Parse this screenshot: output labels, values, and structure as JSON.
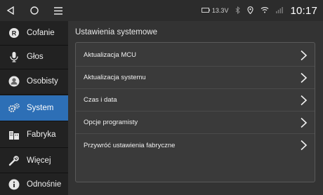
{
  "status_bar": {
    "battery_voltage": "13.3V",
    "time": "10:17"
  },
  "sidebar": {
    "items": [
      {
        "label": "Cofanie",
        "icon": "reverse-icon"
      },
      {
        "label": "Głos",
        "icon": "microphone-icon"
      },
      {
        "label": "Osobisty",
        "icon": "person-icon"
      },
      {
        "label": "System",
        "icon": "gears-icon",
        "active": true
      },
      {
        "label": "Fabryka",
        "icon": "factory-icon"
      },
      {
        "label": "Więcej",
        "icon": "wrench-icon"
      },
      {
        "label": "Odnośnie",
        "icon": "info-icon"
      }
    ]
  },
  "main": {
    "title": "Ustawienia systemowe",
    "rows": [
      {
        "label": "Aktualizacja MCU"
      },
      {
        "label": "Aktualizacja systemu"
      },
      {
        "label": "Czas i data"
      },
      {
        "label": "Opcje programisty"
      },
      {
        "label": "Przywróć ustawienia fabryczne"
      }
    ]
  },
  "colors": {
    "accent": "#2d6fb6",
    "background": "#333333",
    "sidebar": "#222222"
  }
}
